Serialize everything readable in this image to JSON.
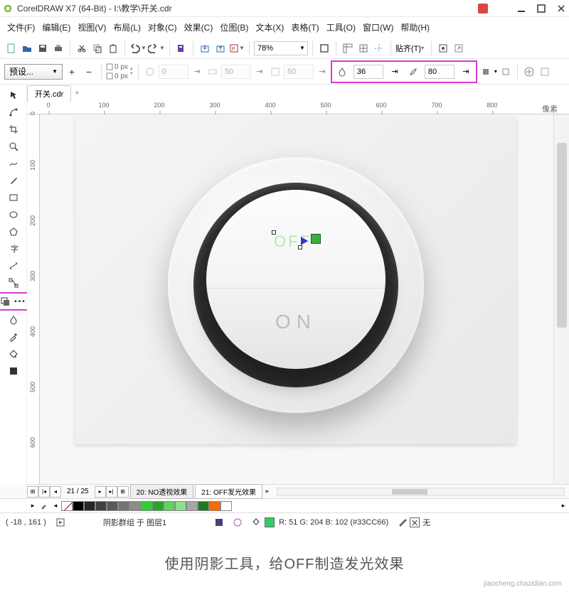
{
  "colors": {
    "highlight": "#d63cd6",
    "accent_green": "#33cc66"
  },
  "window": {
    "title": "CorelDRAW X7 (64-Bit) - I:\\教学\\开关.cdr"
  },
  "menus": [
    "文件(F)",
    "编辑(E)",
    "视图(V)",
    "布局(L)",
    "对象(C)",
    "效果(C)",
    "位图(B)",
    "文本(X)",
    "表格(T)",
    "工具(O)",
    "窗口(W)",
    "帮助(H)"
  ],
  "toolbar1": {
    "zoom": "78%",
    "paste_label": "贴齐(T)"
  },
  "toolbar2": {
    "preset": "预设...",
    "nudgeX": "0 px",
    "nudgeY": "0 px",
    "f1": "0",
    "f2": "50",
    "f3": "50",
    "shadow_opacity": "36",
    "shadow_feather": "80"
  },
  "tabs": {
    "file": "开关.cdr"
  },
  "ruler_h": [
    {
      "v": "0",
      "px": 30
    },
    {
      "v": "100",
      "px": 108
    },
    {
      "v": "200",
      "px": 186
    },
    {
      "v": "300",
      "px": 264
    },
    {
      "v": "400",
      "px": 342
    },
    {
      "v": "500",
      "px": 420
    },
    {
      "v": "600",
      "px": 498
    },
    {
      "v": "700",
      "px": 576
    },
    {
      "v": "800",
      "px": 654
    }
  ],
  "ruler_h_extra": "像素",
  "ruler_v": [
    {
      "v": "0",
      "px": 6
    },
    {
      "v": "100",
      "px": 84
    },
    {
      "v": "200",
      "px": 162
    },
    {
      "v": "300",
      "px": 240
    },
    {
      "v": "400",
      "px": 318
    },
    {
      "v": "500",
      "px": 396
    },
    {
      "v": "600",
      "px": 474
    }
  ],
  "canvas": {
    "on_text": "ON",
    "off_text": "OFF"
  },
  "pages": {
    "count": "21 / 25",
    "tabs": [
      "20: NO透视效果",
      "21: OFF发光效果"
    ]
  },
  "palette": [
    "#000000",
    "#262626",
    "#404040",
    "#595959",
    "#737373",
    "#8c8c8c",
    "#33cc33",
    "#29a329",
    "#5fd35f",
    "#8ce08c",
    "#a6a6a6",
    "#1f7a1f",
    "#ff6600",
    "#ffffff"
  ],
  "status": {
    "coords": "( -18 , 161 )",
    "doc": "阴影群组 于 图层1",
    "color_text": "R: 51 G: 204 B: 102 (#33CC66)",
    "outline": "无"
  },
  "caption": "使用阴影工具，给OFF制造发光效果",
  "footer": "jiaocheng.chazidian.com"
}
